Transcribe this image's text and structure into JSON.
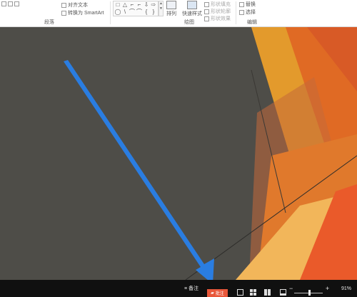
{
  "ribbon": {
    "paragraph": {
      "align_text": "对齐文本",
      "convert_smartart": "转换为 SmartArt",
      "group_label": "段落"
    },
    "drawing": {
      "arrange": "排列",
      "quick_styles": "快速样式",
      "shape_fill": "形状填充",
      "shape_outline": "形状轮廓",
      "shape_effects": "形状效果",
      "group_label": "绘图",
      "shapes": [
        "□",
        "△",
        "⌐",
        "⌐",
        "⇩",
        "⇨",
        "◯",
        "\\",
        "⌒",
        "⌒",
        "{",
        "}"
      ]
    },
    "editing": {
      "replace": "替换",
      "select": "选择",
      "group_label": "编辑"
    }
  },
  "status": {
    "notes_label": "备注",
    "comments_label": "批注",
    "zoom_level": 0.91,
    "zoom_text": "91%",
    "minus": "−",
    "plus": "+"
  },
  "colors": {
    "canvas_bg": "#4e4d48",
    "comment_btn": "#e8573a",
    "annotation_arrow": "#2a7de1",
    "status_bg": "#101010"
  },
  "icons": [
    "notes-icon",
    "comment-icon",
    "normal-view-icon",
    "slide-sorter-icon",
    "reading-view-icon",
    "slideshow-icon"
  ]
}
